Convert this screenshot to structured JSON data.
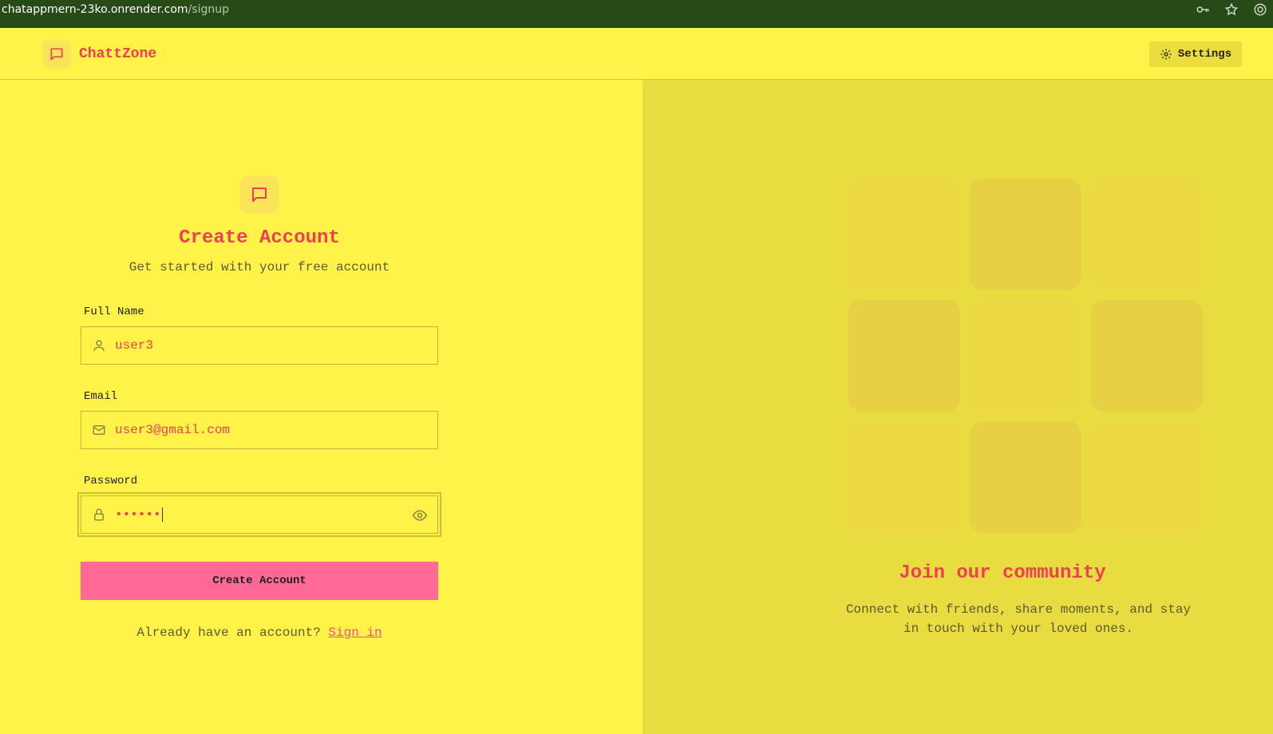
{
  "browser": {
    "url_host": "chatappmern-23ko.onrender.com",
    "url_path": "/signup"
  },
  "navbar": {
    "brand_name": "ChattZone",
    "settings_label": "Settings"
  },
  "form": {
    "title": "Create Account",
    "subtitle": "Get started with your free account",
    "full_name_label": "Full Name",
    "full_name_value": "user3",
    "email_label": "Email",
    "email_value": "user3@gmail.com",
    "password_label": "Password",
    "password_value": "••••••",
    "submit_label": "Create Account",
    "signin_prompt": "Already have an account?",
    "signin_link": "Sign in"
  },
  "community": {
    "title": "Join our community",
    "line1": "Connect with friends, share moments, and stay",
    "line2": "in touch with your loved ones."
  },
  "colors": {
    "background": "#fff34a",
    "panel": "#e8dc40",
    "accent": "#ef3f53",
    "button": "#ff6897"
  }
}
